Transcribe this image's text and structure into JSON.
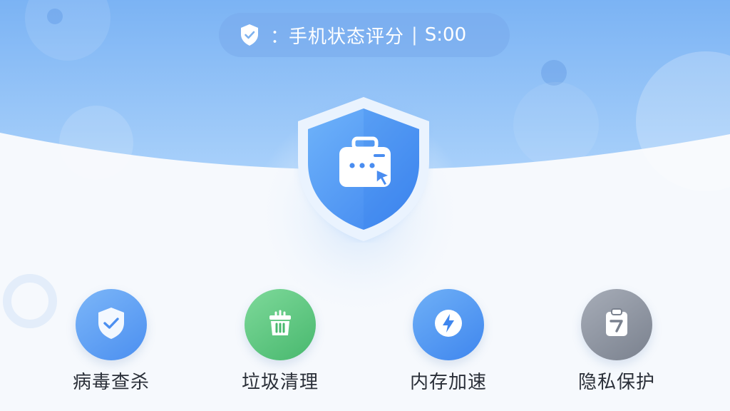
{
  "status_bar": {
    "colon": "：",
    "label": "手机状态评分",
    "separator": "|",
    "score": "S:00"
  },
  "main_shield": {
    "icon": "toolbox-cursor-icon"
  },
  "features": [
    {
      "label": "病毒查杀",
      "icon": "shield-check-icon",
      "color": "#4b8ff0"
    },
    {
      "label": "垃圾清理",
      "icon": "trash-can-icon",
      "color": "#48b86e"
    },
    {
      "label": "内存加速",
      "icon": "lightning-icon",
      "color": "#3f86ee"
    },
    {
      "label": "隐私保护",
      "icon": "clipboard-icon",
      "color": "#7a818e"
    }
  ],
  "colors": {
    "header_top": "#74aef3",
    "header_bottom": "#9cc8f8",
    "background": "#f6f9fd"
  }
}
